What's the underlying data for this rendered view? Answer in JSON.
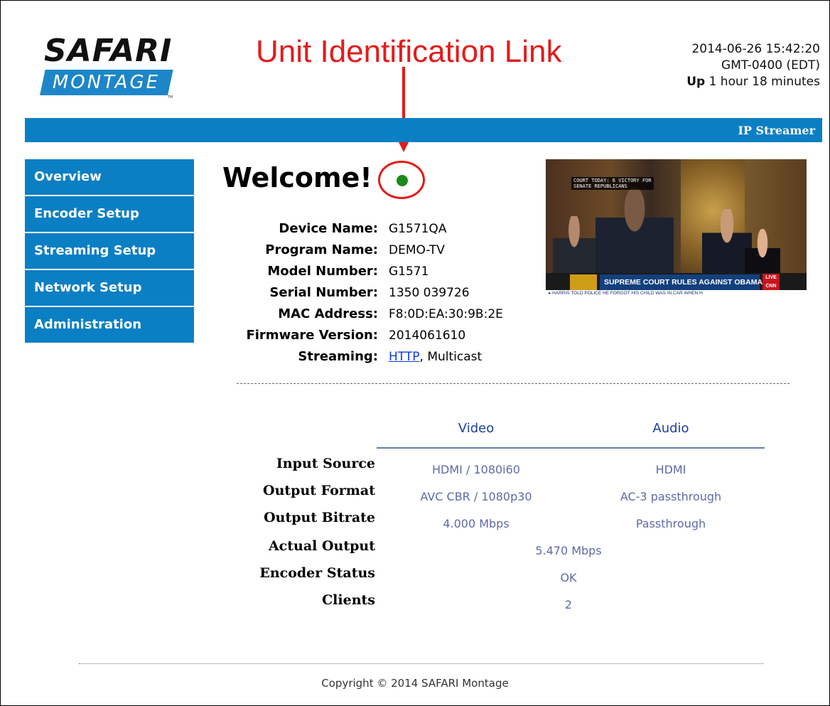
{
  "logo": {
    "line1": "SAFARI",
    "line2": "MONTAGE",
    "tm": "TM"
  },
  "annotation": {
    "text": "Unit Identification Link",
    "color": "#e41b1b"
  },
  "header": {
    "datetime": "2014-06-26 15:42:20",
    "timezone": "GMT-0400 (EDT)",
    "uptime_label": "Up",
    "uptime_value": "1 hour 18 minutes"
  },
  "top_bar": {
    "title": "IP Streamer",
    "color": "#0b7fc3"
  },
  "sidebar": {
    "items": [
      {
        "label": "Overview"
      },
      {
        "label": "Encoder Setup"
      },
      {
        "label": "Streaming Setup"
      },
      {
        "label": "Network Setup"
      },
      {
        "label": "Administration"
      }
    ]
  },
  "welcome": {
    "title": "Welcome!",
    "status_color": "#1a8a1a"
  },
  "device": {
    "rows": [
      {
        "label": "Device Name:",
        "value": "G1571QA"
      },
      {
        "label": "Program Name:",
        "value": "DEMO-TV"
      },
      {
        "label": "Model Number:",
        "value": "G1571"
      },
      {
        "label": "Serial Number:",
        "value": "1350 039726"
      },
      {
        "label": "MAC Address:",
        "value": "F8:0D:EA:30:9B:2E"
      },
      {
        "label": "Firmware Version:",
        "value": "2014061610"
      }
    ],
    "streaming_label": "Streaming:",
    "streaming_link": "HTTP",
    "streaming_rest": ", Multicast"
  },
  "preview": {
    "top_caption_1": "COURT TODAY: 6 VICTORY FOR",
    "top_caption_2": "SENATE REPUBLICANS",
    "headline": "SUPREME COURT RULES AGAINST OBAMA",
    "live": "LIVE",
    "network": "CNN",
    "ticker": "▸ HARRIS TOLD POLICE HE FORGOT HIS CHILD WAS IN CAR WHEN H"
  },
  "status_table": {
    "col_video": "Video",
    "col_audio": "Audio",
    "rows": {
      "input_source": {
        "label": "Input Source",
        "video": "HDMI / 1080i60",
        "audio": "HDMI"
      },
      "output_format": {
        "label": "Output Format",
        "video": "AVC CBR / 1080p30",
        "audio": "AC-3 passthrough"
      },
      "output_bitrate": {
        "label": "Output Bitrate",
        "video": "4.000 Mbps",
        "audio": "Passthrough"
      },
      "actual_output": {
        "label": "Actual Output",
        "value": "5.470 Mbps"
      },
      "encoder_status": {
        "label": "Encoder Status",
        "value": "OK"
      },
      "clients": {
        "label": "Clients",
        "value": "2"
      }
    }
  },
  "footer": {
    "copyright": "Copyright © 2014 SAFARI Montage"
  }
}
